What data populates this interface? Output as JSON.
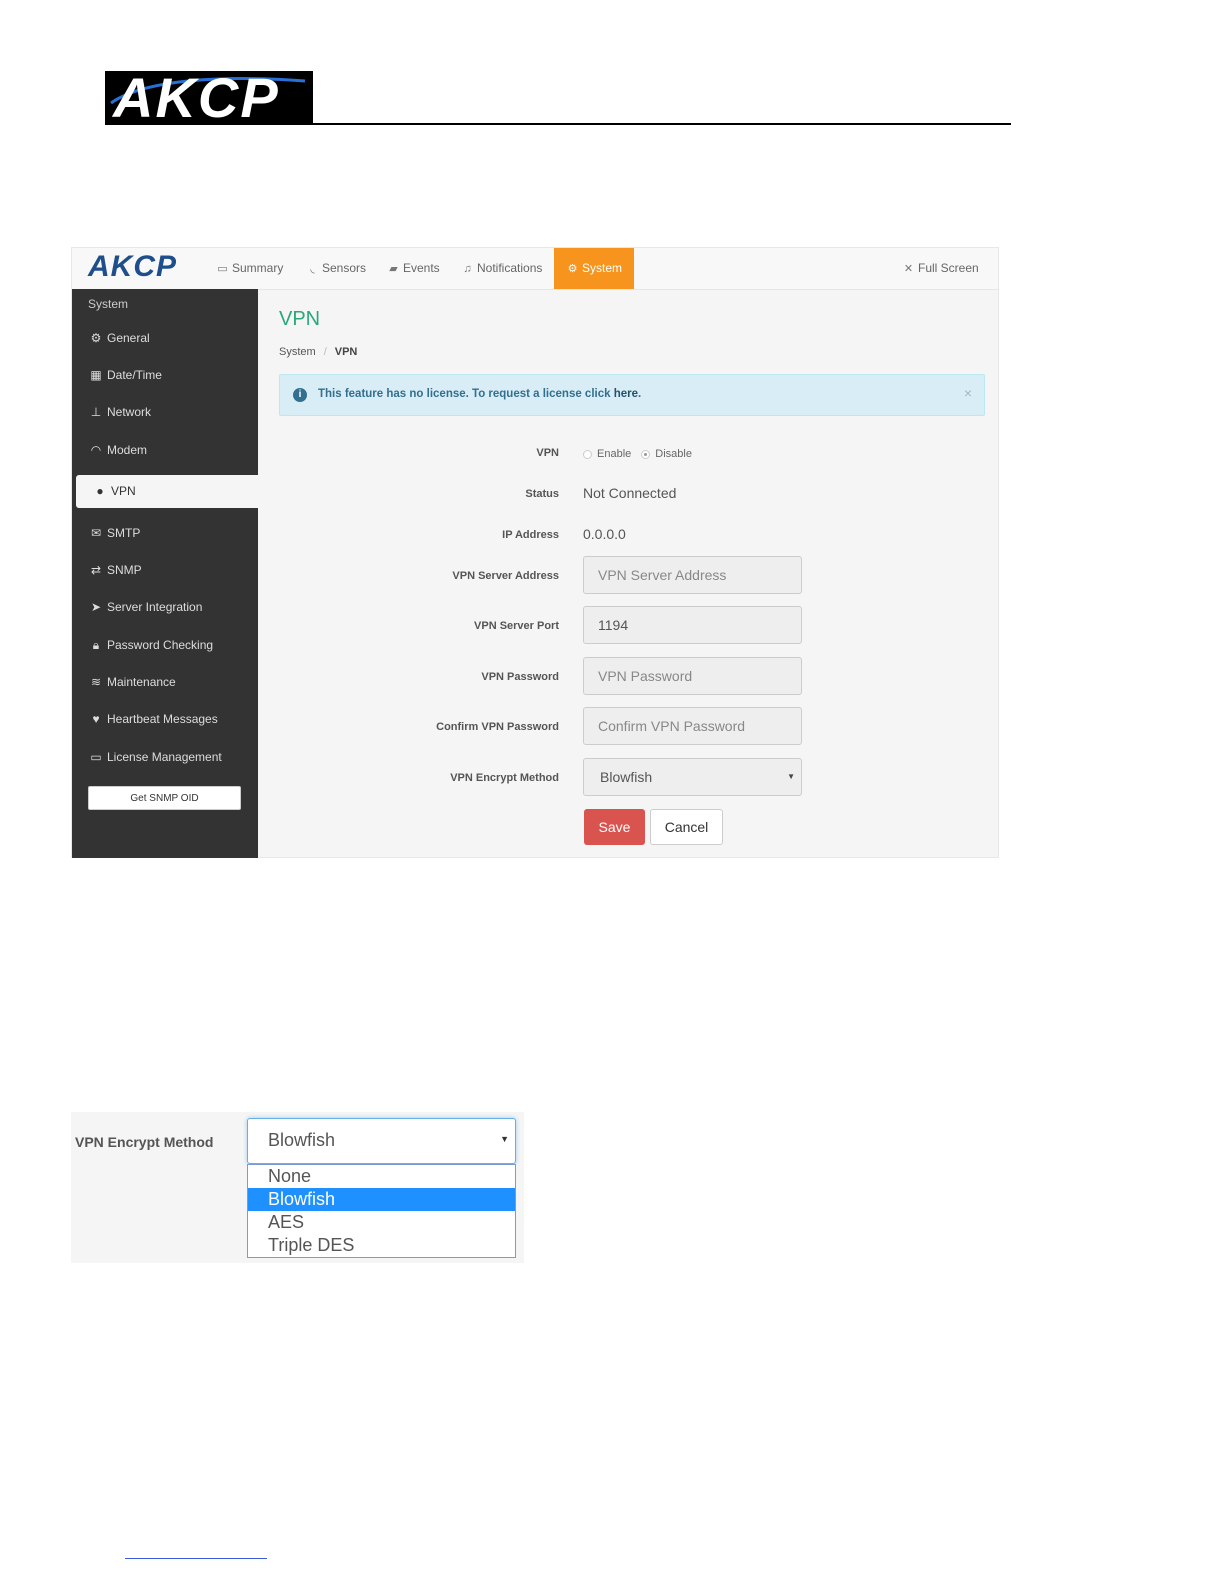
{
  "document": {
    "logo_text": "AKCP"
  },
  "app": {
    "logo_text": "AKCP",
    "nav": [
      {
        "label": "Summary",
        "icon": "monitor-icon"
      },
      {
        "label": "Sensors",
        "icon": "rss-icon"
      },
      {
        "label": "Events",
        "icon": "book-icon"
      },
      {
        "label": "Notifications",
        "icon": "bell-icon"
      },
      {
        "label": "System",
        "icon": "gears-icon",
        "active": true
      }
    ],
    "fullscreen_label": "Full Screen"
  },
  "sidebar": {
    "heading": "System",
    "items": [
      {
        "label": "General",
        "icon": "gears-icon"
      },
      {
        "label": "Date/Time",
        "icon": "calendar-icon"
      },
      {
        "label": "Network",
        "icon": "sitemap-icon"
      },
      {
        "label": "Modem",
        "icon": "wifi-icon"
      },
      {
        "label": "VPN",
        "icon": "globe-icon",
        "active": true
      },
      {
        "label": "SMTP",
        "icon": "envelope-icon"
      },
      {
        "label": "SNMP",
        "icon": "exchange-icon"
      },
      {
        "label": "Server Integration",
        "icon": "paper-plane-icon"
      },
      {
        "label": "Password Checking",
        "icon": "lock-icon"
      },
      {
        "label": "Maintenance",
        "icon": "database-icon"
      },
      {
        "label": "Heartbeat Messages",
        "icon": "heart-icon"
      },
      {
        "label": "License Management",
        "icon": "credit-card-icon"
      }
    ],
    "snmp_oid_button": "Get SNMP OID"
  },
  "main": {
    "title": "VPN",
    "breadcrumb": {
      "parent": "System",
      "separator": "/",
      "current": "VPN"
    },
    "alert": {
      "text": "This feature has no license. To request a license click ",
      "link": "here",
      "suffix": ".",
      "close": "×",
      "icon": "info-circle-icon"
    },
    "form": {
      "vpn_label": "VPN",
      "enable_label": "Enable",
      "disable_label": "Disable",
      "selected": "Disable",
      "status_label": "Status",
      "status_value": "Not Connected",
      "ip_label": "IP Address",
      "ip_value": "0.0.0.0",
      "server_address_label": "VPN Server Address",
      "server_address_placeholder": "VPN Server Address",
      "server_port_label": "VPN Server Port",
      "server_port_value": "1194",
      "password_label": "VPN Password",
      "password_placeholder": "VPN Password",
      "confirm_password_label": "Confirm VPN Password",
      "confirm_password_placeholder": "Confirm VPN Password",
      "encrypt_label": "VPN Encrypt Method",
      "encrypt_value": "Blowfish",
      "save_label": "Save",
      "cancel_label": "Cancel"
    }
  },
  "dropdown_detail": {
    "label": "VPN Encrypt Method",
    "selected_value": "Blowfish",
    "options": [
      "None",
      "Blowfish",
      "AES",
      "Triple DES"
    ],
    "highlighted": "Blowfish"
  },
  "colors": {
    "accent": "#f7941d",
    "sidebar_bg": "#333333",
    "title_green": "#2aa87a",
    "danger": "#d9534f",
    "info_bg": "#d9edf7",
    "highlight": "#1e90ff"
  }
}
